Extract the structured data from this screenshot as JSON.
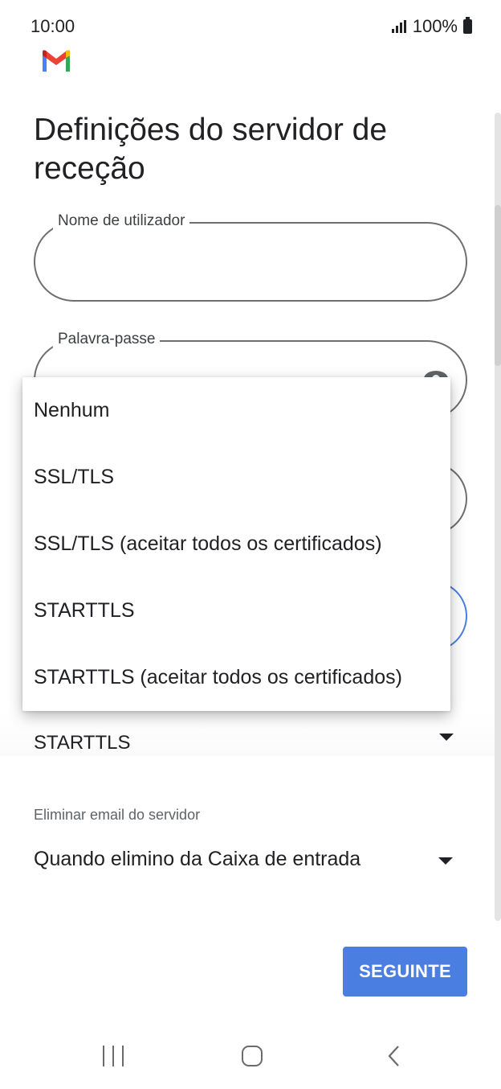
{
  "status_bar": {
    "time": "10:00",
    "battery": "100%"
  },
  "app": {
    "logo": "gmail-logo"
  },
  "page": {
    "title": "Definições do servidor de receção"
  },
  "fields": {
    "username": {
      "label": "Nome de utilizador",
      "value": ""
    },
    "password": {
      "label": "Palavra-passe",
      "value": ""
    }
  },
  "security": {
    "value": "STARTTLS"
  },
  "delete_email": {
    "label": "Eliminar email do servidor",
    "value": "Quando elimino da Caixa de entrada"
  },
  "dropdown_menu": {
    "options": [
      "Nenhum",
      "SSL/TLS",
      "SSL/TLS (aceitar todos os certificados)",
      "STARTTLS",
      "STARTTLS (aceitar todos os certificados)"
    ]
  },
  "buttons": {
    "next": "SEGUINTE"
  },
  "nav": {
    "icons": [
      "recent-apps-icon",
      "home-icon",
      "back-icon"
    ]
  },
  "colors": {
    "accent": "#4a7ee0",
    "text": "#202124"
  }
}
